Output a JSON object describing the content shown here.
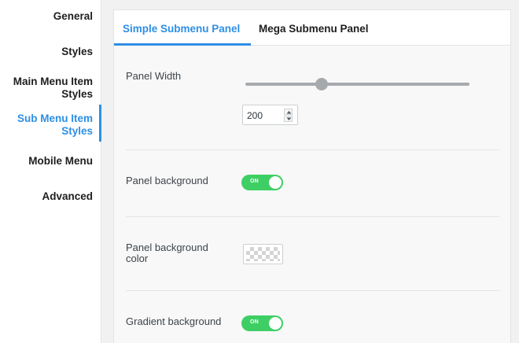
{
  "sidebar": {
    "items": [
      {
        "label": "General"
      },
      {
        "label": "Styles"
      },
      {
        "label_line1": "Main Menu Item",
        "label_line2": "Styles"
      },
      {
        "label_line1": "Sub Menu Item",
        "label_line2": "Styles"
      },
      {
        "label": "Mobile Menu"
      },
      {
        "label": "Advanced"
      }
    ],
    "active_item": "Sub Menu Item Styles"
  },
  "tabs": [
    {
      "label": "Simple Submenu Panel",
      "active": true
    },
    {
      "label": "Mega Submenu Panel",
      "active": false
    }
  ],
  "settings": {
    "panel_width": {
      "label": "Panel Width",
      "value": "200",
      "slider_fraction": 0.32
    },
    "panel_background": {
      "label": "Panel background",
      "toggle_text": "ON",
      "state": "on"
    },
    "panel_background_color": {
      "label_line1": "Panel background",
      "label_line2": "color",
      "value": "transparent"
    },
    "gradient_background": {
      "label": "Gradient background",
      "toggle_text": "ON",
      "state": "on"
    }
  },
  "colors": {
    "accent": "#2e8fe6",
    "toggle_on": "#3ecf64",
    "slider": "#a7aaad"
  }
}
